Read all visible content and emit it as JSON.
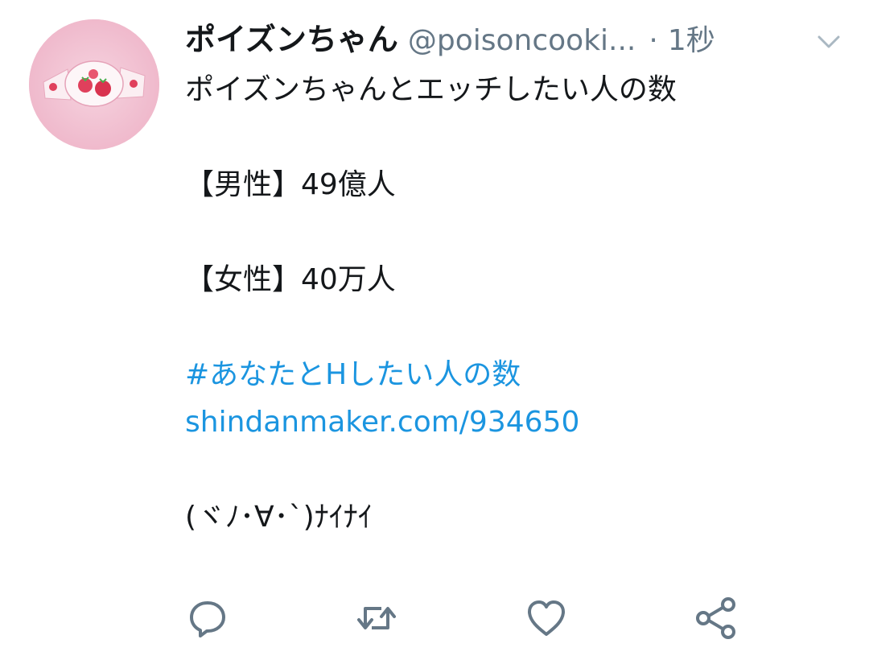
{
  "tweet": {
    "author": {
      "display_name": "ポイズンちゃん",
      "handle": "@poisoncooki...",
      "avatar_icon": "strawberry-candy-avatar"
    },
    "separator": "·",
    "timestamp": "1秒",
    "menu_icon": "chevron-down-icon",
    "lines": {
      "l1": "ポイズンちゃんとエッチしたい人の数",
      "l2": "【男性】49億人",
      "l3": "【女性】40万人",
      "hashtag": "#あなたとHしたい人の数",
      "url": "shindanmaker.com/934650",
      "emoticon": "(ヾﾉ･∀･`)ﾅｲﾅｲ"
    },
    "actions": {
      "reply_icon": "reply-icon",
      "retweet_icon": "retweet-icon",
      "like_icon": "heart-icon",
      "share_icon": "share-icon"
    }
  },
  "colors": {
    "text": "#14171a",
    "secondary": "#657786",
    "link": "#1b95e0",
    "icon": "#657786"
  }
}
